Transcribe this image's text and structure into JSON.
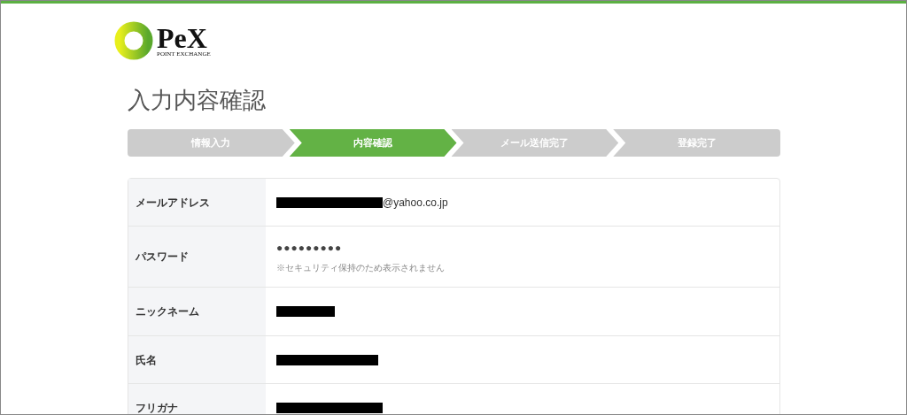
{
  "logo": {
    "name": "PeX",
    "tagline": "POINT EXCHANGE"
  },
  "page_title": "入力内容確認",
  "steps": [
    {
      "label": "情報入力",
      "selected": false
    },
    {
      "label": "内容確認",
      "selected": true
    },
    {
      "label": "メール送信完了",
      "selected": false
    },
    {
      "label": "登録完了",
      "selected": false
    }
  ],
  "fields": [
    {
      "label": "メールアドレス",
      "value": [
        {
          "kind": "redacted"
        },
        {
          "kind": "text",
          "text": "@yahoo.co.jp"
        }
      ]
    },
    {
      "label": "パスワード",
      "value": [
        {
          "kind": "dots",
          "text": "●●●●●●●●●"
        },
        {
          "kind": "note",
          "text": "※セキュリティ保持のため表示されません"
        }
      ]
    },
    {
      "label": "ニックネーム",
      "value": [
        {
          "kind": "redacted"
        }
      ]
    },
    {
      "label": "氏名",
      "value": [
        {
          "kind": "redacted"
        }
      ]
    },
    {
      "label": "フリガナ",
      "value": [
        {
          "kind": "redacted"
        }
      ]
    }
  ]
}
